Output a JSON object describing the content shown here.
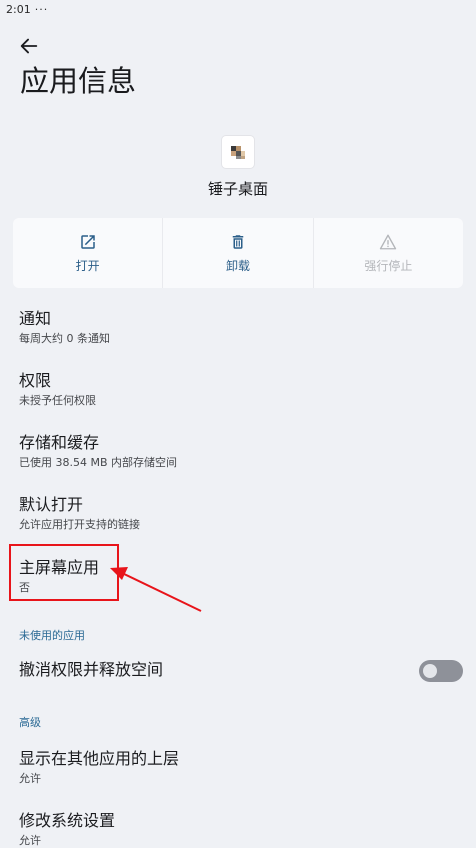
{
  "status_bar": {
    "time": "2:01",
    "more": "···"
  },
  "header": {
    "title": "应用信息"
  },
  "app": {
    "name": "锤子桌面"
  },
  "actions": [
    {
      "label": "打开",
      "icon": "open-external-icon",
      "enabled": true
    },
    {
      "label": "卸载",
      "icon": "trash-icon",
      "enabled": true
    },
    {
      "label": "强行停止",
      "icon": "warning-icon",
      "enabled": false
    }
  ],
  "settings": [
    {
      "title": "通知",
      "subtitle": "每周大约 0 条通知"
    },
    {
      "title": "权限",
      "subtitle": "未授予任何权限"
    },
    {
      "title": "存储和缓存",
      "subtitle": "已使用 38.54 MB 内部存储空间"
    },
    {
      "title": "默认打开",
      "subtitle": "允许应用打开支持的链接"
    },
    {
      "title": "主屏幕应用",
      "subtitle": "否"
    }
  ],
  "unused_section": {
    "header": "未使用的应用",
    "toggle_label": "撤消权限并释放空间",
    "toggle_on": false
  },
  "advanced_section": {
    "header": "高级",
    "items": [
      {
        "title": "显示在其他应用的上层",
        "subtitle": "允许"
      },
      {
        "title": "修改系统设置",
        "subtitle": "允许"
      }
    ]
  },
  "colors": {
    "accent": "#2b5e89",
    "annotation": "#e8141a",
    "background": "#eff1f5"
  }
}
